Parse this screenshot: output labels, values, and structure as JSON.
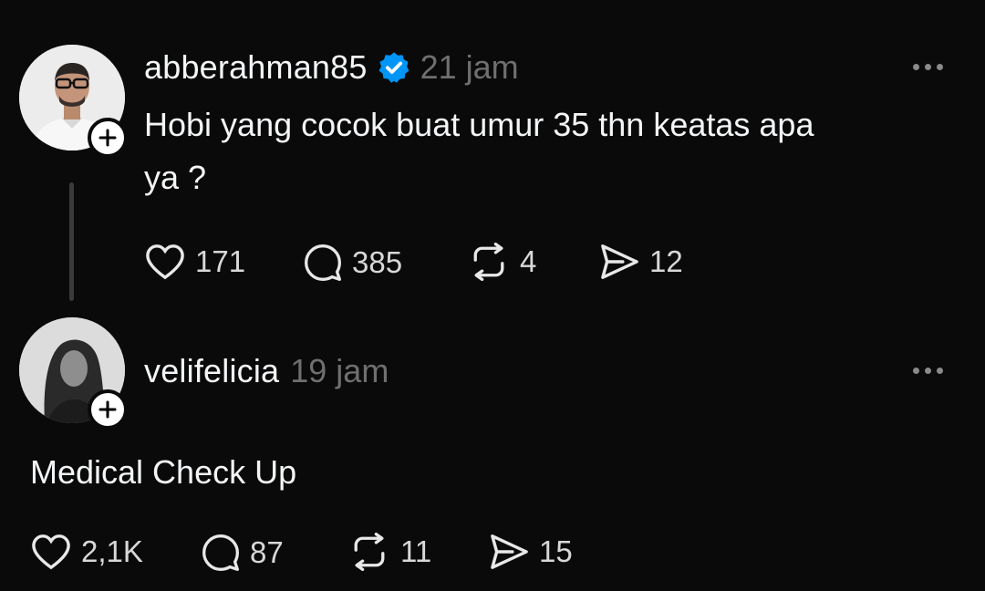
{
  "post1": {
    "username": "abberahman85",
    "verified": true,
    "time": "21 jam",
    "text_line1": "Hobi yang cocok buat umur 35 thn keatas apa",
    "text_line2": "ya ?",
    "likes": "171",
    "replies": "385",
    "reposts": "4",
    "shares": "12"
  },
  "post2": {
    "username": "velifelicia",
    "time": "19 jam",
    "text": "Medical Check Up",
    "likes": "2,1K",
    "replies": "87",
    "reposts": "11",
    "shares": "15"
  },
  "colors": {
    "background": "#0a0a0a",
    "text": "#f3f5f7",
    "muted": "#6f6f6f",
    "verified_badge": "#0095f6"
  },
  "icons": [
    "heart-icon",
    "comment-icon",
    "repost-icon",
    "share-icon",
    "more-icon",
    "follow-plus-icon",
    "verified-badge-icon"
  ]
}
